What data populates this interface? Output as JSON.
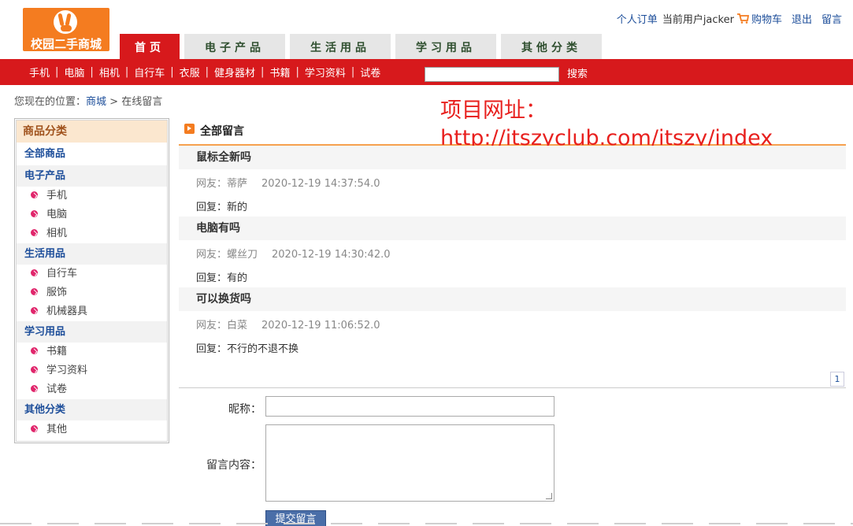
{
  "header": {
    "logo_text": "校园二手商城",
    "links": {
      "orders": "个人订单",
      "current_user": "当前用户jacker",
      "cart": "购物车",
      "logout": "退出",
      "message": "留言"
    },
    "tabs": [
      {
        "label": "首页",
        "active": true
      },
      {
        "label": "电子产品",
        "active": false
      },
      {
        "label": "生活用品",
        "active": false
      },
      {
        "label": "学习用品",
        "active": false
      },
      {
        "label": "其他分类",
        "active": false
      }
    ],
    "categories": [
      "手机",
      "电脑",
      "相机",
      "自行车",
      "衣服",
      "健身器材",
      "书籍",
      "学习资料",
      "试卷"
    ],
    "search": {
      "value": "",
      "button": "搜索"
    }
  },
  "breadcrumb": {
    "prefix": "您现在的位置：",
    "home": "商城",
    "sep": ">",
    "current": "在线留言"
  },
  "sidebar": {
    "title": "商品分类",
    "all": "全部商品",
    "groups": [
      {
        "name": "电子产品",
        "items": [
          "手机",
          "电脑",
          "相机"
        ]
      },
      {
        "name": "生活用品",
        "items": [
          "自行车",
          "服饰",
          "机械器具"
        ]
      },
      {
        "name": "学习用品",
        "items": [
          "书籍",
          "学习资料",
          "试卷"
        ]
      },
      {
        "name": "其他分类",
        "items": [
          "其他"
        ]
      }
    ]
  },
  "main": {
    "title": "全部留言",
    "watermark": "项目网址：http://itszyclub.com/itszy/index",
    "messages": [
      {
        "question": "鼠标全新吗",
        "user": "网友：蒂萨",
        "time": "2020-12-19 14:37:54.0",
        "reply": "回复：新的"
      },
      {
        "question": "电脑有吗",
        "user": "网友：螺丝刀",
        "time": "2020-12-19 14:30:42.0",
        "reply": "回复：有的"
      },
      {
        "question": "可以换货吗",
        "user": "网友：白菜",
        "time": "2020-12-19 11:06:52.0",
        "reply": "回复：不行的不退不换"
      }
    ],
    "page": "1",
    "form": {
      "nickname_label": "昵称：",
      "nickname_value": "",
      "content_label": "留言内容：",
      "content_value": "",
      "submit": "提交留言"
    }
  },
  "colors": {
    "brand_red": "#d7191c",
    "brand_orange": "#f47c20",
    "link_blue": "#1d4e9a",
    "sidebar_header_bg": "#fbe7cf",
    "accent_line": "#f6a14e"
  },
  "icons": {
    "logo": "victory-hand-logo",
    "cart": "shopping-cart-icon",
    "section": "arrow-right-icon",
    "bullet": "pink-arrow-bullet-icon"
  }
}
